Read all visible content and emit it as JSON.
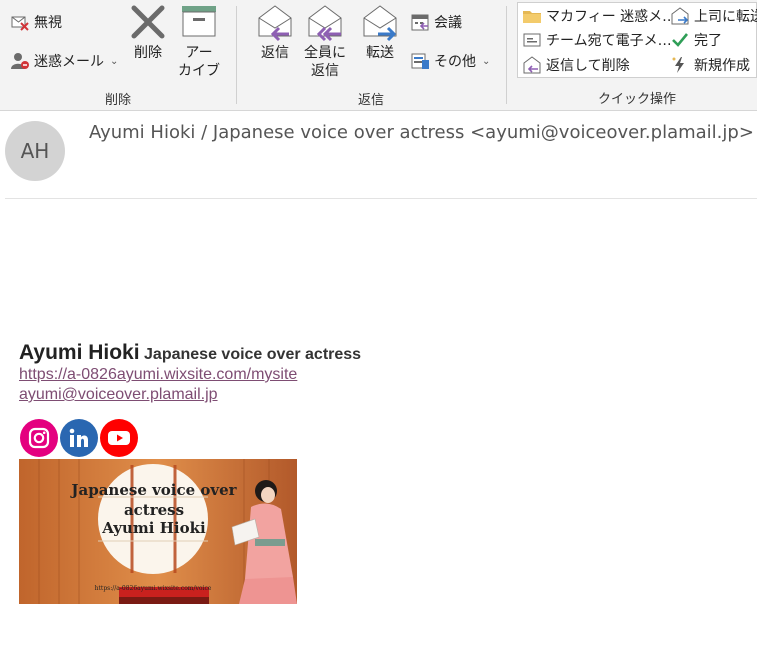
{
  "ribbon": {
    "delete_group": {
      "label": "削除",
      "ignore": "無視",
      "junk": "迷惑メール",
      "delete": "削除",
      "archive_line1": "アー",
      "archive_line2": "カイブ"
    },
    "respond_group": {
      "label": "返信",
      "reply": "返信",
      "reply_all_line1": "全員に",
      "reply_all_line2": "返信",
      "forward": "転送",
      "meeting": "会議",
      "more": "その他"
    },
    "quick_steps": {
      "label": "クイック操作",
      "items": [
        "マカフィー 迷惑メ…",
        "上司に転送",
        "チーム宛て電子メ…",
        "完了",
        "返信して削除",
        "新規作成"
      ]
    }
  },
  "message": {
    "avatar_initials": "AH",
    "sender": "Ayumi Hioki / Japanese voice over actress <ayumi@voiceover.plamail.jp>"
  },
  "signature": {
    "name": "Ayumi Hioki",
    "title": "Japanese voice over actress",
    "website": "https://a-0826ayumi.wixsite.com/mysite",
    "email": "ayumi@voiceover.plamail.jp",
    "social": [
      "instagram-icon",
      "linkedin-icon",
      "youtube-icon"
    ],
    "banner": {
      "line1": "Japanese voice over",
      "line2": "actress",
      "line3": "Ayumi Hioki",
      "url": "https://a-0826ayumi.wixsite.com/voice"
    }
  },
  "colors": {
    "link": "#7e4d73",
    "instagram": "#e4007f",
    "linkedin": "#2a67b1",
    "youtube": "#ff0000",
    "accent_purple": "#8e5fb3",
    "accent_blue": "#3a7ac9"
  }
}
